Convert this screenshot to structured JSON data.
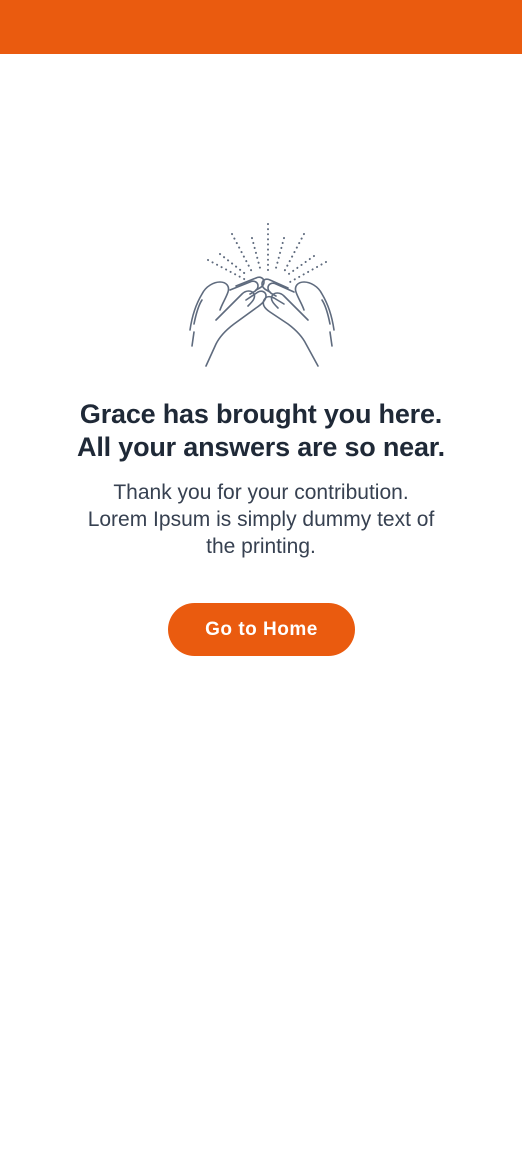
{
  "colors": {
    "accent": "#ea5b0f",
    "heading": "#1f2937",
    "body_text": "#374151",
    "illustration_stroke": "#5f6b7e"
  },
  "illustration": {
    "icon": "clapping-hands-icon"
  },
  "headline": {
    "line1": "Grace has brought you here.",
    "line2": "All your answers are so near."
  },
  "message": {
    "line1": "Thank you for your contribution.",
    "line2": "Lorem Ipsum is simply dummy text of",
    "line3": "the printing."
  },
  "home_button": {
    "label": "Go to Home"
  }
}
